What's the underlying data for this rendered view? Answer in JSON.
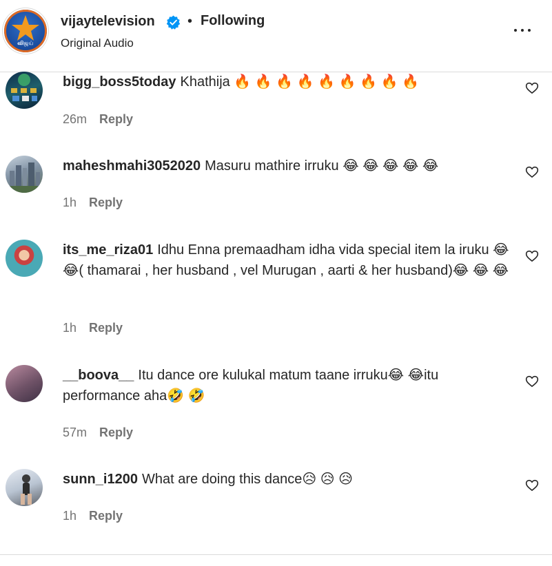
{
  "header": {
    "account_name": "vijaytelevision",
    "separator": "•",
    "follow_status": "Following",
    "audio_label": "Original Audio",
    "logo_text": "விஜய்",
    "verified_color": "#0095f6"
  },
  "icons": {
    "verified": "verified-badge-icon",
    "more": "more-options-icon",
    "like": "heart-icon"
  },
  "comments": [
    {
      "username": "bigg_boss5today",
      "text": "Khathija 🔥 🔥 🔥 🔥 🔥 🔥 🔥 🔥 🔥",
      "time": "26m",
      "reply": "Reply"
    },
    {
      "username": "maheshmahi3052020",
      "text": "Masuru mathire irruku 😂 😂 😂 😂 😂",
      "time": "1h",
      "reply": "Reply"
    },
    {
      "username": "its_me_riza01",
      "text": "Idhu Enna premaadham idha vida special item la iruku 😂 😂( thamarai , her husband , vel Murugan , aarti & her husband)😂 😂 😂",
      "time": "1h",
      "reply": "Reply"
    },
    {
      "username": "__boova__",
      "text": "Itu dance ore kulukal matum taane irruku😂 😂itu performance aha🤣 🤣",
      "time": "57m",
      "reply": "Reply"
    },
    {
      "username": "sunn_i1200",
      "text": "What are doing this dance😥 😥 😥",
      "time": "1h",
      "reply": "Reply"
    }
  ]
}
